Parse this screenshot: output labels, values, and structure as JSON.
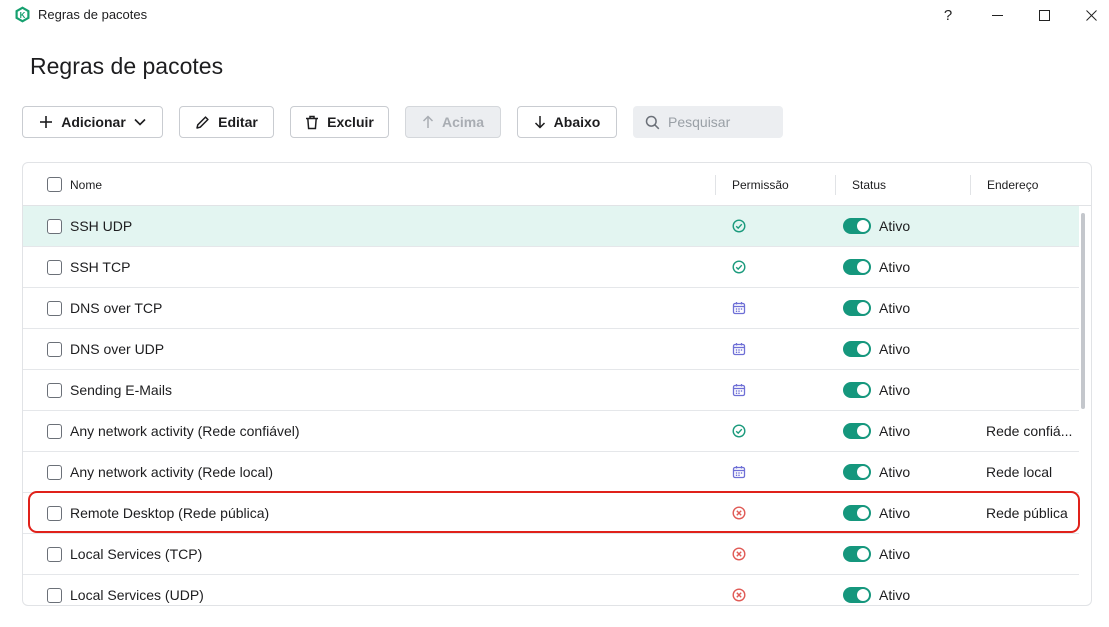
{
  "window": {
    "title": "Regras de pacotes",
    "help_glyph": "?",
    "app_icon": "kaspersky-k-icon"
  },
  "page": {
    "title": "Regras de pacotes"
  },
  "toolbar": {
    "add_label": "Adicionar",
    "edit_label": "Editar",
    "delete_label": "Excluir",
    "up_label": "Acima",
    "down_label": "Abaixo",
    "search_placeholder": "Pesquisar"
  },
  "table": {
    "columns": {
      "name": "Nome",
      "permission": "Permissão",
      "status": "Status",
      "address": "Endereço"
    },
    "rows": [
      {
        "name": "SSH UDP",
        "permission": "allow",
        "status": "Ativo",
        "address": "",
        "selected": true
      },
      {
        "name": "SSH TCP",
        "permission": "allow",
        "status": "Ativo",
        "address": ""
      },
      {
        "name": "DNS over TCP",
        "permission": "schedule",
        "status": "Ativo",
        "address": ""
      },
      {
        "name": "DNS over UDP",
        "permission": "schedule",
        "status": "Ativo",
        "address": ""
      },
      {
        "name": "Sending E-Mails",
        "permission": "schedule",
        "status": "Ativo",
        "address": ""
      },
      {
        "name": "Any network activity (Rede confiável)",
        "permission": "allow",
        "status": "Ativo",
        "address": "Rede confiá..."
      },
      {
        "name": "Any network activity (Rede local)",
        "permission": "schedule",
        "status": "Ativo",
        "address": "Rede local"
      },
      {
        "name": "Remote Desktop (Rede pública)",
        "permission": "block",
        "status": "Ativo",
        "address": "Rede pública",
        "highlighted": true
      },
      {
        "name": "Local Services (TCP)",
        "permission": "block",
        "status": "Ativo",
        "address": ""
      },
      {
        "name": "Local Services (UDP)",
        "permission": "block",
        "status": "Ativo",
        "address": ""
      }
    ]
  },
  "colors": {
    "accent": "#15977d",
    "allow": "#1a9a7c",
    "schedule": "#6e6fd6",
    "block": "#e05a55",
    "highlight": "#e0211a"
  }
}
